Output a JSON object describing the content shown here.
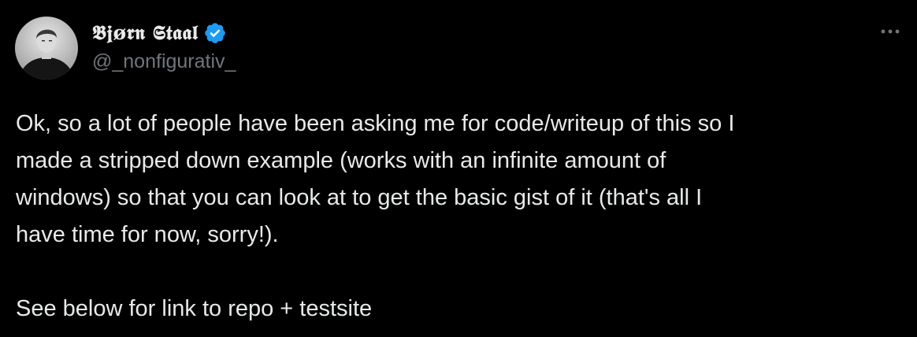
{
  "author": {
    "display_name": "𝕭𝖏ø𝖗𝖓 𝕾𝖙𝖆𝖆𝖑",
    "handle": "@_nonfigurativ_",
    "verified_icon": "verified-badge-icon",
    "avatar_icon": "profile-avatar"
  },
  "menu": {
    "more_icon": "more-horizontal-icon"
  },
  "tweet": {
    "paragraph_1": "Ok, so a lot of people have been asking me for code/writeup of this so I\nmade a stripped down example (works with an infinite amount of\nwindows) so that you can look at to get the basic gist of it (that's all I\nhave time for now, sorry!).",
    "paragraph_2": "See below for link to repo + testsite"
  },
  "colors": {
    "background": "#000000",
    "text": "#e7e9ea",
    "secondary": "#71767b",
    "verified_blue": "#1d9bf0"
  }
}
